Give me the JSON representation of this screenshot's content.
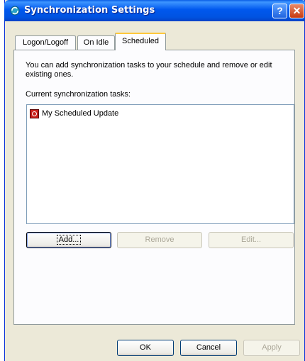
{
  "window": {
    "title": "Synchronization Settings"
  },
  "titlebar": {
    "help_label": "?",
    "close_label": "✕"
  },
  "tabs": [
    {
      "label": "Logon/Logoff",
      "active": false
    },
    {
      "label": "On Idle",
      "active": false
    },
    {
      "label": "Scheduled",
      "active": true
    }
  ],
  "scheduled": {
    "description": "You can add synchronization tasks to your schedule and remove or edit existing ones.",
    "list_label": "Current synchronization tasks:",
    "tasks": [
      {
        "label": "My Scheduled Update",
        "icon": "scheduled-task-icon"
      }
    ],
    "add_label": "Add...",
    "remove_label": "Remove",
    "edit_label": "Edit..."
  },
  "footer": {
    "ok_label": "OK",
    "cancel_label": "Cancel",
    "apply_label": "Apply"
  }
}
